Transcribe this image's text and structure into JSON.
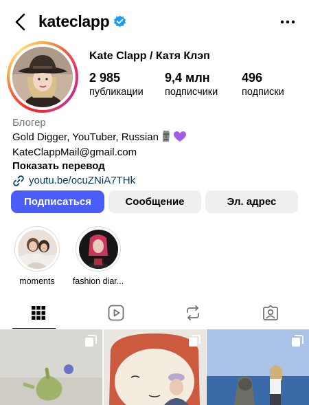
{
  "profile": {
    "username": "kateclapp",
    "display_name": "Kate Clapp / Катя Клэп",
    "verified": true
  },
  "stats": {
    "posts_count": "2 985",
    "posts_label": "публикации",
    "followers_count": "9,4 млн",
    "followers_label": "подписчики",
    "following_count": "496",
    "following_label": "подписки"
  },
  "bio": {
    "category": "Блогер",
    "line1": "Gold Digger, YouTuber, Russian",
    "emojis": [
      "moai-icon",
      "purple-heart-icon"
    ],
    "email": "KateClappMail@gmail.com",
    "translate": "Показать перевод",
    "link": "youtu.be/ocuZNiA7THk"
  },
  "buttons": {
    "follow": "Подписаться",
    "message": "Сообщение",
    "email": "Эл. адрес"
  },
  "highlights": [
    {
      "label": "moments"
    },
    {
      "label": "fashion diar..."
    }
  ],
  "tabs": [
    "grid-icon",
    "reels-icon",
    "reposts-icon",
    "tagged-icon"
  ],
  "colors": {
    "accent": "#4a5df9",
    "verified": "#1d9bf0",
    "link": "#00376b",
    "muted": "#737373"
  }
}
